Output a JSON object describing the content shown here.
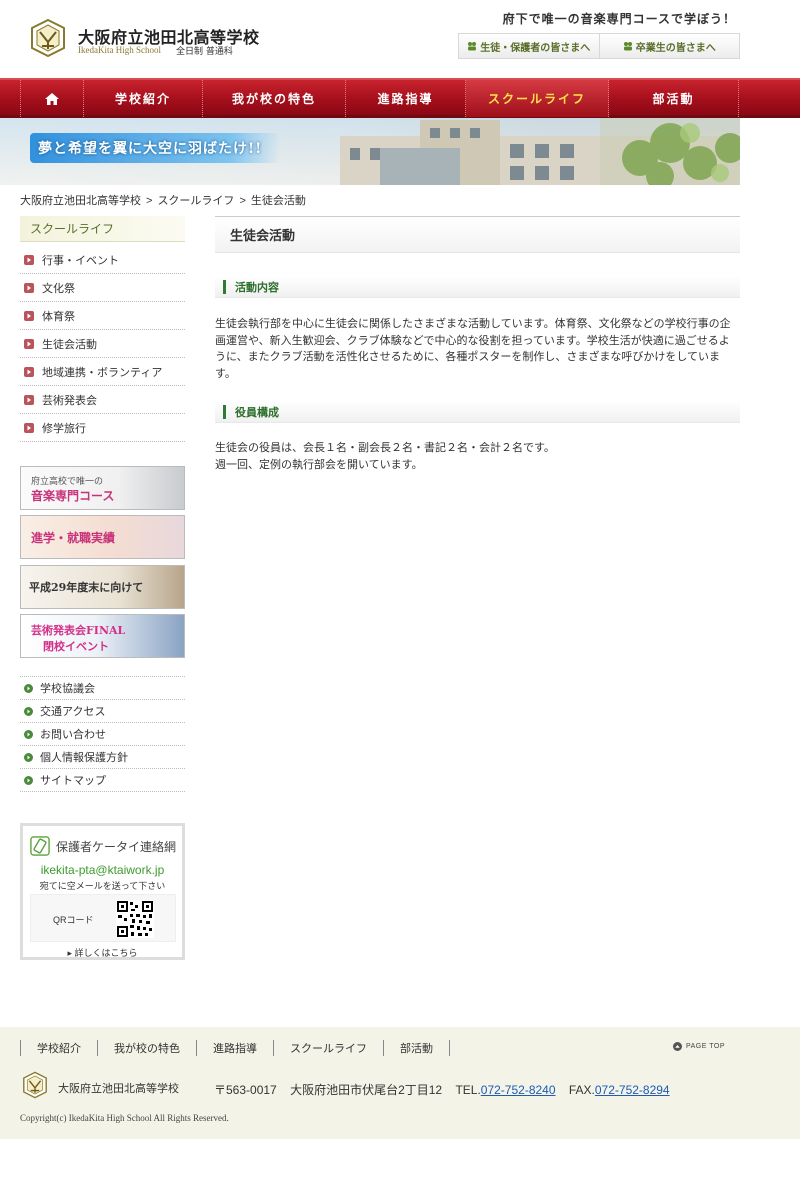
{
  "header": {
    "school_name": "大阪府立池田北高等学校",
    "school_name_en": "IkedaKita High School",
    "school_sub": "全日制 普通科",
    "tagline": "府下で唯一の音楽専門コースで学ぼう！",
    "buttons": [
      "生徒・保護者の皆さまへ",
      "卒業生の皆さまへ"
    ]
  },
  "gnav": {
    "items": [
      "学校紹介",
      "我が校の特色",
      "進路指導",
      "スクールライフ",
      "部活動"
    ],
    "current": "スクールライフ"
  },
  "banner": {
    "caption": "夢と希望を翼に大空に羽ばたけ!!"
  },
  "breadcrumb": [
    "大阪府立池田北高等学校",
    "スクールライフ",
    "生徒会活動"
  ],
  "breadcrumb_sep": ">",
  "sidebar": {
    "heading": "スクールライフ",
    "items": [
      "行事・イベント",
      "文化祭",
      "体育祭",
      "生徒会活動",
      "地域連携・ボランティア",
      "芸術発表会",
      "修学旅行"
    ],
    "banners": {
      "music_l1": "府立高校で唯一の",
      "music_l2": "音楽専門コース",
      "shinro": "進学・就職実績",
      "h29": "平成29年度末に向けて",
      "final_l1": "芸術発表会FINAL",
      "final_l2": "閉校イベント"
    },
    "links": [
      "学校協議会",
      "交通アクセス",
      "お問い合わせ",
      "個人情報保護方針",
      "サイトマップ"
    ],
    "pta": {
      "title": "保護者ケータイ連絡網",
      "email": "ikekita-pta@ktaiwork.jp",
      "note": "宛てに空メールを送って下さい",
      "qr_label": "QRコード",
      "more": "▸ 詳しくはこちら"
    }
  },
  "main": {
    "title": "生徒会活動",
    "sections": [
      {
        "heading": "活動内容",
        "body": "生徒会執行部を中心に生徒会に関係したさまざまな活動しています。体育祭、文化祭などの学校行事の企画運営や、新入生歓迎会、クラブ体験などで中心的な役割を担っています。学校生活が快適に過ごせるように、またクラブ活動を活性化させるために、各種ポスターを制作し、さまざまな呼びかけをしています。"
      },
      {
        "heading": "役員構成",
        "body_lines": [
          "生徒会の役員は、会長１名・副会長２名・書記２名・会計２名です。",
          "週一回、定例の執行部会を開いています。"
        ]
      }
    ]
  },
  "footer": {
    "nav": [
      "学校紹介",
      "我が校の特色",
      "進路指導",
      "スクールライフ",
      "部活動"
    ],
    "pagetop": "PAGE TOP",
    "school_name": "大阪府立池田北高等学校",
    "postal": "〒563-0017",
    "address": "大阪府池田市伏尾台2丁目12",
    "tel_label": "TEL.",
    "tel": "072-752-8240",
    "fax_label": "FAX.",
    "fax": "072-752-8294",
    "copyright": "Copyright(c) IkedaKita High School All Rights Reserved."
  },
  "colors": {
    "nav_red": "#a50f1c",
    "nav_current_text": "#ffe04a",
    "accent_green": "#2f7a35",
    "link_blue": "#1d5bb5",
    "footer_bg": "#f3f3e7"
  }
}
